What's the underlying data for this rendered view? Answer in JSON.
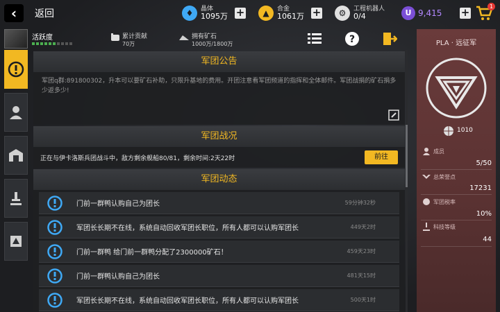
{
  "topbar": {
    "back_label": "返回",
    "crystal": {
      "label": "晶体",
      "value": "1095万"
    },
    "alloy": {
      "label": "合金",
      "value": "1061万"
    },
    "robots": {
      "label": "工程机器人",
      "value": "0/4"
    },
    "u_currency": {
      "icon_letter": "U",
      "value": "9,415"
    },
    "cart_badge": "1"
  },
  "player": {
    "name": "活跃度",
    "activity_level": 0.6,
    "contribution": {
      "label": "累计贡献",
      "value": "70万"
    },
    "ore": {
      "label": "拥有矿石",
      "value": "1000万/1800万"
    }
  },
  "tools": [
    "list-icon",
    "help-icon",
    "exit-icon"
  ],
  "tabs": [
    "notice-icon",
    "member-icon",
    "base-icon",
    "research-icon",
    "fleet-icon"
  ],
  "notice": {
    "title": "军团公告",
    "body": "军团q群:891800302，升本可以要矿石补助，只限升基地的费用。开团注意看军团频道的指挥和全体邮件。军团战捐的矿石捐多少返多少!"
  },
  "battle": {
    "title": "军团战况",
    "text": "正在与伊卡洛斯兵团战斗中，敌方剩余舰船80/81，剩余时间:2天22时",
    "goto_label": "前往"
  },
  "feed": {
    "title": "军团动态",
    "items": [
      {
        "text": "门前一群鸭认购自己为团长",
        "time": "59分钟32秒"
      },
      {
        "text": "军团长长期不在线，系统自动回收军团长职位，所有人都可以认购军团长",
        "time": "449天2时"
      },
      {
        "text": "门前一群鸭 给门前一群鸭分配了2300000矿石！",
        "time": "459天23时"
      },
      {
        "text": "门前一群鸭认购自己为团长",
        "time": "481天15时"
      },
      {
        "text": "军团长长期不在线，系统自动回收军团长职位，所有人都可以认购军团长",
        "time": "500天1时"
      }
    ]
  },
  "legion": {
    "name": "PLA · 远征军",
    "id": "1010",
    "members": {
      "label": "成员",
      "value": "5/50"
    },
    "honor": {
      "label": "总荣誉点",
      "value": "17231"
    },
    "tax": {
      "label": "军团税率",
      "value": "10%"
    },
    "tech": {
      "label": "科技等级",
      "value": "44"
    }
  },
  "colors": {
    "accent": "#f2b822",
    "panel_red": "#6a3b3b",
    "currency_purple": "#7b4fd6"
  }
}
